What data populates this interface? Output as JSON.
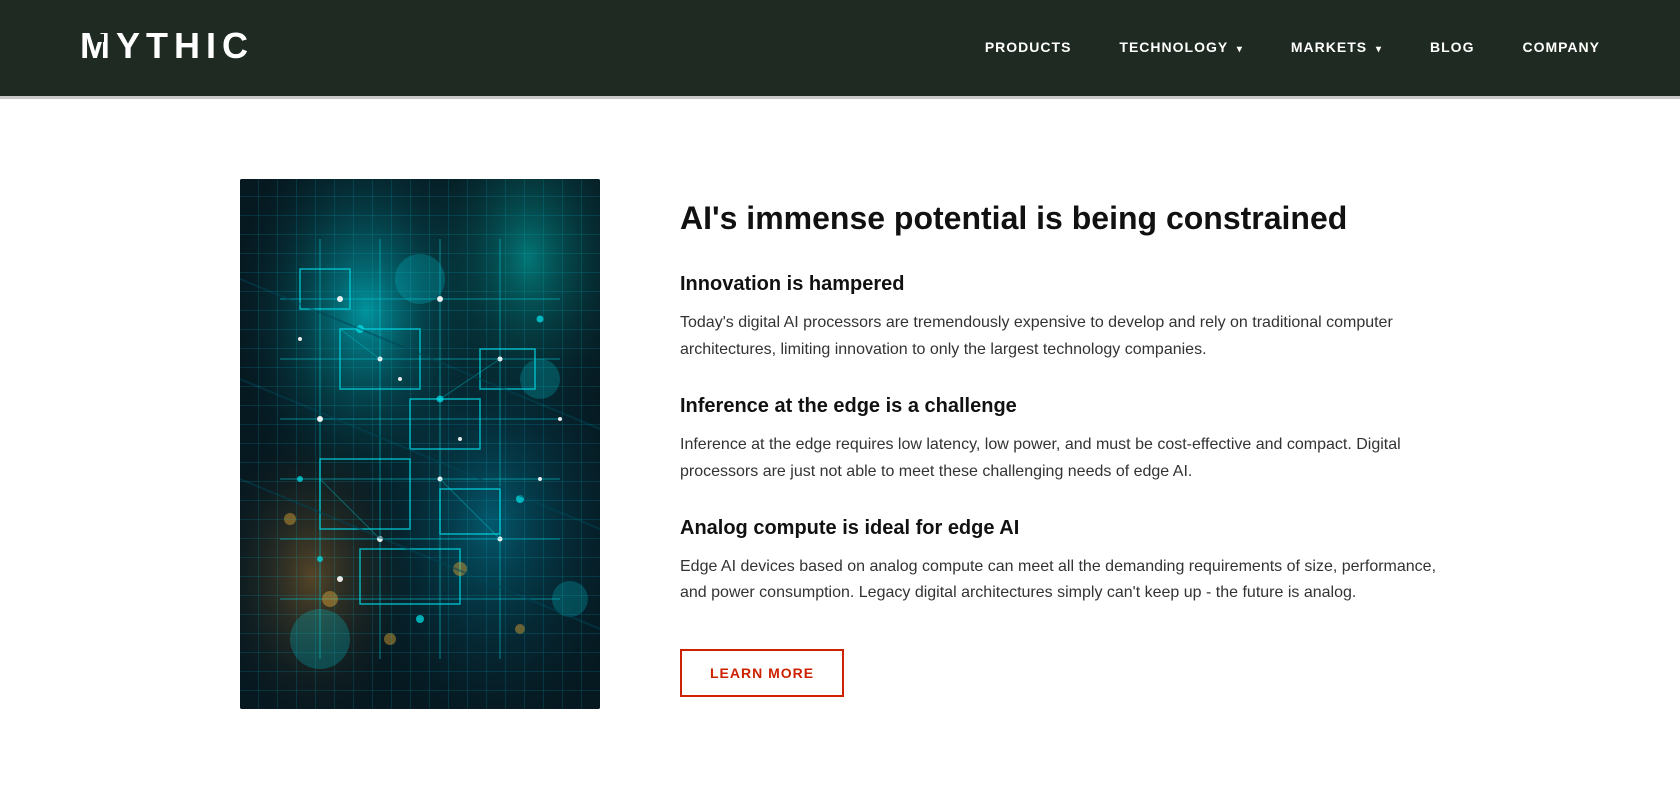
{
  "nav": {
    "logo": "MYTHIC",
    "links": [
      {
        "label": "PRODUCTS",
        "has_dropdown": false
      },
      {
        "label": "TECHNOLOGY",
        "has_dropdown": true
      },
      {
        "label": "MARKETS",
        "has_dropdown": true
      },
      {
        "label": "BLOG",
        "has_dropdown": false
      },
      {
        "label": "COMPANY",
        "has_dropdown": false
      }
    ]
  },
  "main": {
    "headline": "AI's immense potential is being constrained",
    "sections": [
      {
        "title": "Innovation is hampered",
        "body": "Today's digital AI processors are tremendously expensive to develop and rely on traditional computer architectures, limiting innovation to only the largest technology companies."
      },
      {
        "title": "Inference at the edge is a challenge",
        "body": "Inference at the edge requires low latency, low power, and must be cost-effective and compact. Digital processors are just not able to meet these challenging needs of edge AI."
      },
      {
        "title": "Analog compute is ideal for edge AI",
        "body": "Edge AI devices based on analog compute can meet all the demanding requirements of size, performance, and power consumption. Legacy digital architectures simply can't keep up - the future is analog."
      }
    ],
    "cta_label": "LEARN MORE"
  },
  "colors": {
    "nav_bg": "#1e2a22",
    "cta_border": "#cc2200",
    "cta_text": "#cc2200"
  }
}
